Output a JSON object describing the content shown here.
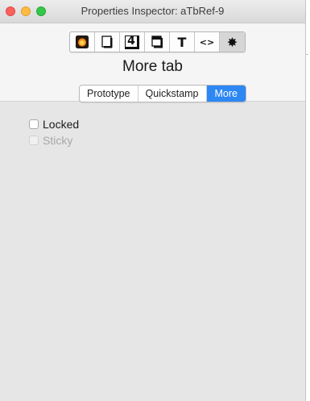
{
  "window": {
    "title": "Properties Inspector: aTbRef-9",
    "edge_glyph": "."
  },
  "toolbar": {
    "buttons": [
      {
        "name": "appearance",
        "icon": "appearance-icon"
      },
      {
        "name": "text",
        "icon": "document-icon"
      },
      {
        "name": "count",
        "icon": "count-icon",
        "glyph": "4"
      },
      {
        "name": "window",
        "icon": "window-icon"
      },
      {
        "name": "text-format",
        "icon": "text-format-icon",
        "glyph": "T"
      },
      {
        "name": "action",
        "icon": "code-icon",
        "glyph": "<>"
      },
      {
        "name": "settings",
        "icon": "gear-icon",
        "glyph": "✸"
      }
    ],
    "active_index": 6
  },
  "heading": "More tab",
  "tabs": {
    "items": [
      "Prototype",
      "Quickstamp",
      "More"
    ],
    "selected": "More"
  },
  "options": {
    "locked": {
      "label": "Locked",
      "checked": false,
      "enabled": true
    },
    "sticky": {
      "label": "Sticky",
      "checked": false,
      "enabled": false
    }
  },
  "colors": {
    "accent": "#2d87f4",
    "close": "#fc605c",
    "minimize": "#fdbc40",
    "zoom": "#34c84a",
    "panel": "#e6e6e6"
  }
}
